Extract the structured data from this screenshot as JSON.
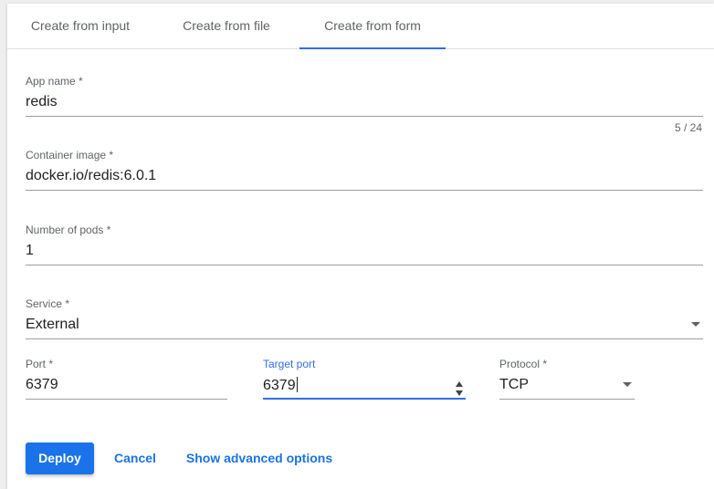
{
  "tabs": [
    {
      "label": "Create from input",
      "active": false
    },
    {
      "label": "Create from file",
      "active": false
    },
    {
      "label": "Create from form",
      "active": true
    }
  ],
  "form": {
    "app_name": {
      "label": "App name *",
      "value": "redis",
      "counter": "5 / 24"
    },
    "container_image": {
      "label": "Container image *",
      "value": "docker.io/redis:6.0.1"
    },
    "number_of_pods": {
      "label": "Number of pods *",
      "value": "1"
    },
    "service": {
      "label": "Service *",
      "value": "External"
    },
    "port": {
      "label": "Port *",
      "value": "6379"
    },
    "target_port": {
      "label": "Target port",
      "value": "6379",
      "focused": true
    },
    "protocol": {
      "label": "Protocol *",
      "value": "TCP"
    }
  },
  "actions": {
    "deploy_label": "Deploy",
    "cancel_label": "Cancel",
    "advanced_label": "Show advanced options"
  },
  "colors": {
    "accent": "#326de6",
    "primary_button": "#1a73e8",
    "link": "#1a73e8"
  },
  "icons": {
    "dropdown": "chevron-down-icon",
    "stepper": "stepper-icon"
  }
}
